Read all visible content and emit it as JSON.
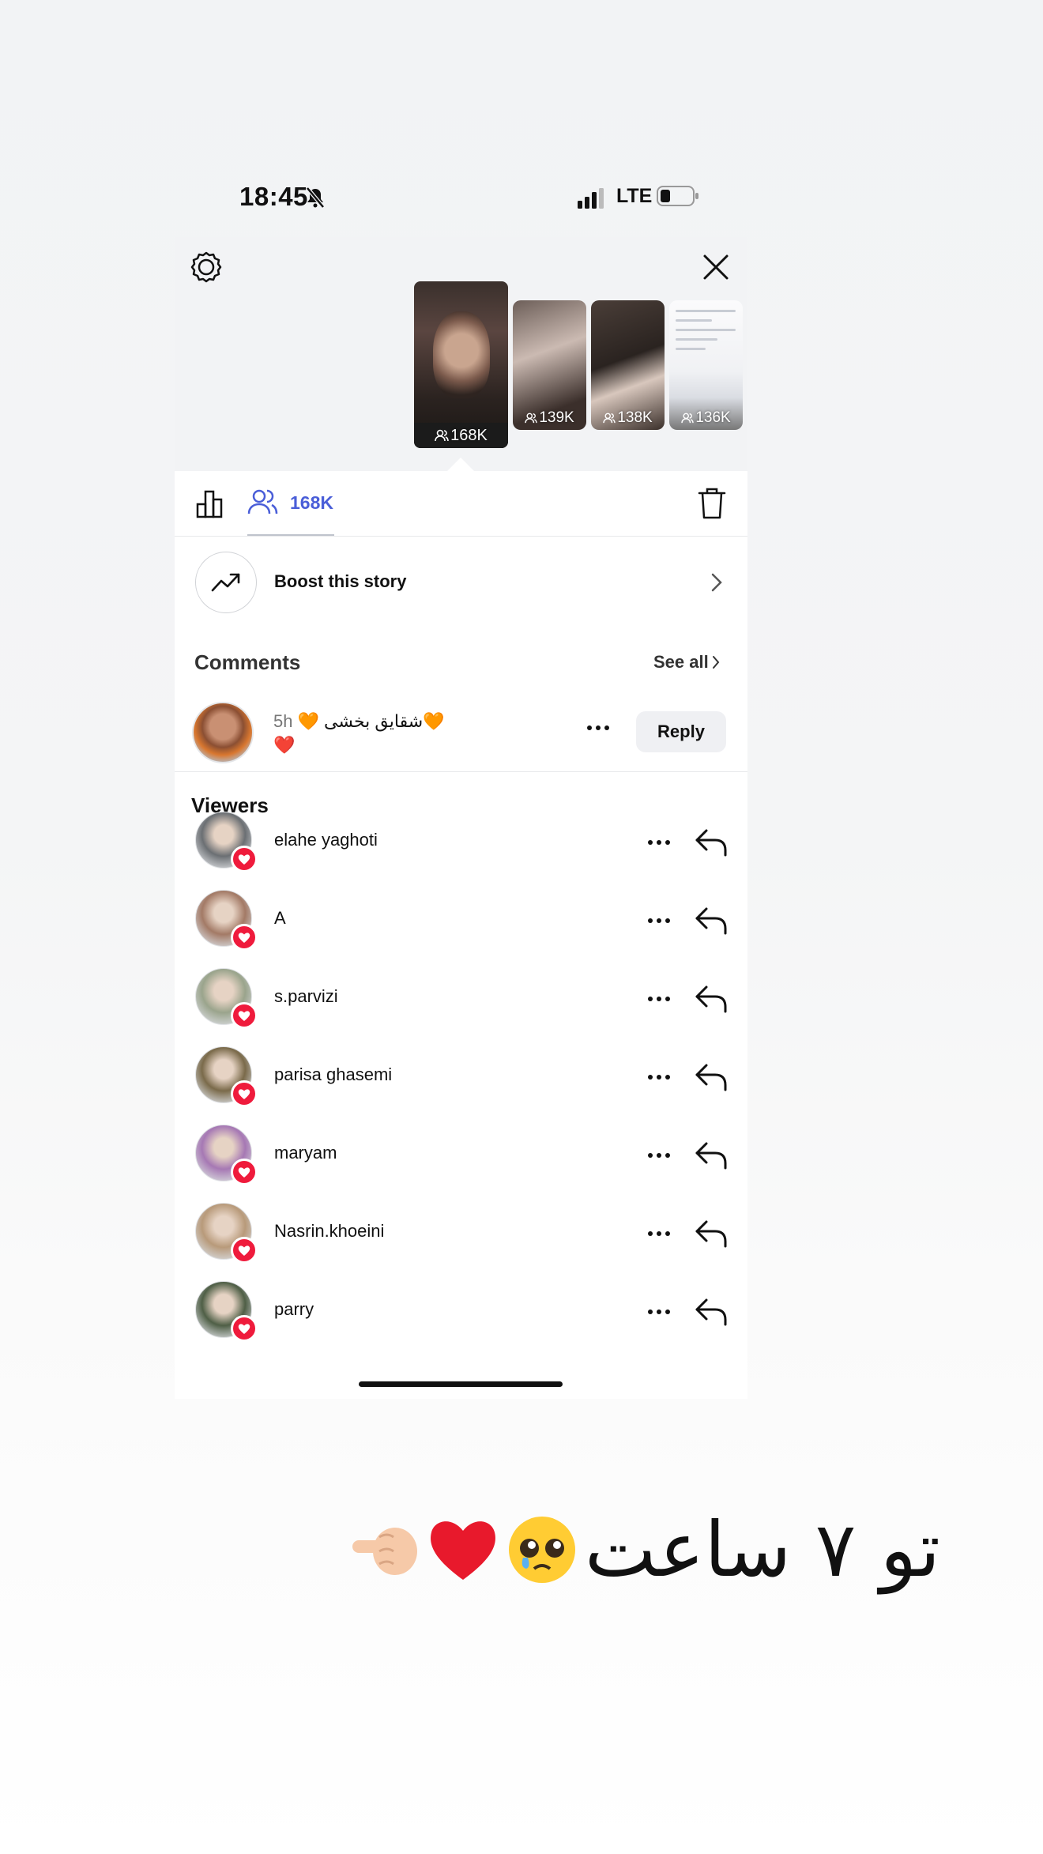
{
  "status_bar": {
    "time": "18:45",
    "network": "LTE"
  },
  "stories": [
    {
      "viewers": "168K",
      "selected": true
    },
    {
      "viewers": "139K"
    },
    {
      "viewers": "138K"
    },
    {
      "viewers": "136K"
    }
  ],
  "tabs": {
    "viewers_count": "168K"
  },
  "boost": {
    "label": "Boost this story"
  },
  "comments": {
    "title": "Comments",
    "see_all": "See all",
    "items": [
      {
        "time": "5h",
        "text": "🧡 شقایق بخشی🧡",
        "emoji_line": "❤️",
        "reply_label": "Reply"
      }
    ]
  },
  "viewers": {
    "title": "Viewers",
    "items": [
      {
        "name": "elahe yaghoti",
        "avatar_color": "#6b6f73"
      },
      {
        "name": "A",
        "avatar_color": "#a37a66"
      },
      {
        "name": "s.parvizi",
        "avatar_color": "#9aa48c"
      },
      {
        "name": "parisa ghasemi",
        "avatar_color": "#7a6a4a"
      },
      {
        "name": "maryam",
        "avatar_color": "#a678b4"
      },
      {
        "name": "Nasrin.khoeini",
        "avatar_color": "#b89a7a"
      },
      {
        "name": "parry",
        "avatar_color": "#4f5f46"
      }
    ]
  },
  "caption": {
    "text": "تو ۷ ساعت"
  },
  "colors": {
    "accent": "#4a5ed8",
    "heart": "#ef1b3c"
  }
}
